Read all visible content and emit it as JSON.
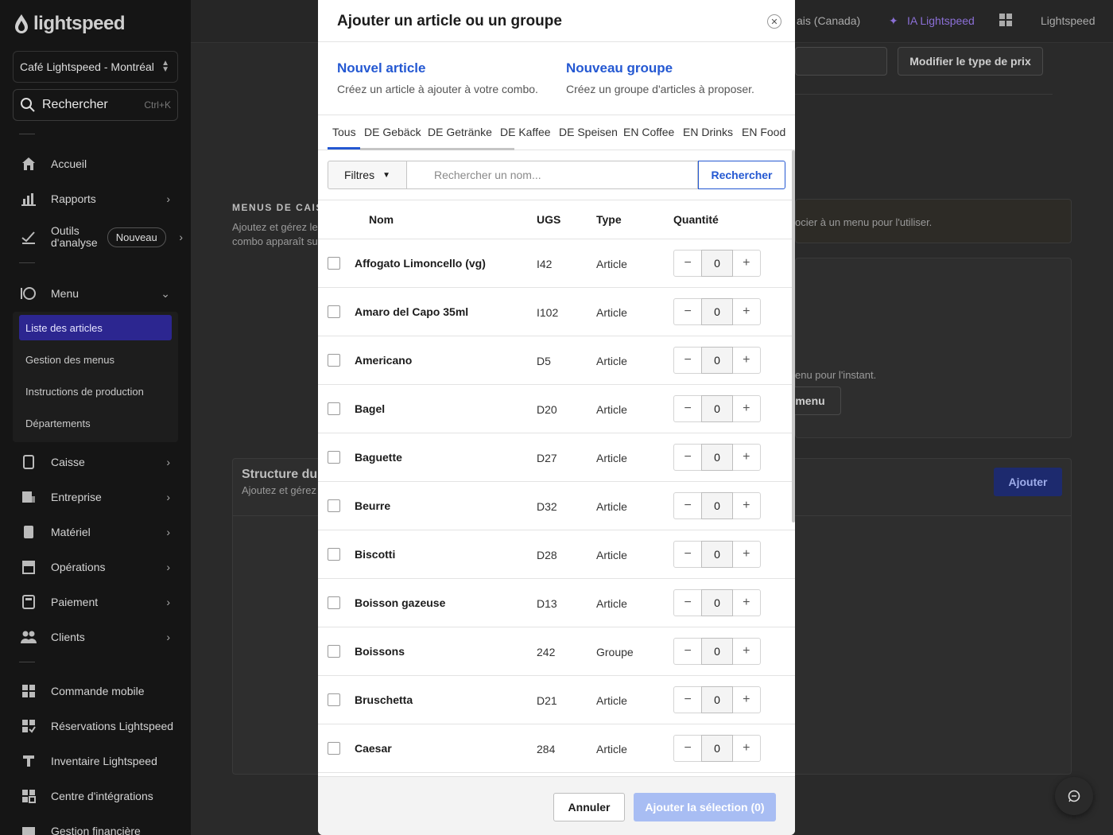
{
  "sidebar": {
    "brand": "lightspeed",
    "location": "Café Lightspeed - Montréal",
    "search_label": "Rechercher",
    "search_shortcut": "Ctrl+K",
    "items": [
      {
        "label": "Accueil"
      },
      {
        "label": "Rapports"
      },
      {
        "label": "Outils d'analyse",
        "line1": "Outils",
        "line2": "d'analyse",
        "badge": "Nouveau"
      },
      {
        "label": "Menu"
      },
      {
        "label": "Caisse"
      },
      {
        "label": "Entreprise"
      },
      {
        "label": "Matériel"
      },
      {
        "label": "Opérations"
      },
      {
        "label": "Paiement"
      },
      {
        "label": "Clients"
      },
      {
        "label": "Commande mobile"
      },
      {
        "label": "Réservations Lightspeed"
      },
      {
        "label": "Inventaire Lightspeed"
      },
      {
        "label": "Centre d'intégrations"
      },
      {
        "label": "Gestion financière"
      }
    ],
    "menu_sub": [
      "Liste des articles",
      "Gestion des menus",
      "Instructions de production",
      "Départements"
    ]
  },
  "background": {
    "topbar_language": "ais (Canada)",
    "topbar_ai": "IA Lightspeed",
    "topbar_account": "Lightspeed",
    "change_price_type": "Modifier le type de prix",
    "pos_menus_title": "MENUS DE CAIS",
    "pos_menus_desc1": "Ajoutez et gérez le",
    "pos_menus_desc2": "combo apparaît su",
    "associate_hint": "ocier à un menu pour l'utiliser.",
    "no_menu_text": "enu pour l'instant.",
    "menu_btn": "menu",
    "structure_title": "Structure du c",
    "structure_desc": "Ajoutez et gérez",
    "add_btn": "Ajouter"
  },
  "modal": {
    "title": "Ajouter un article ou un groupe",
    "new_item": {
      "title": "Nouvel article",
      "desc": "Créez un article à ajouter à votre combo."
    },
    "new_group": {
      "title": "Nouveau groupe",
      "desc": "Créez un groupe d'articles à proposer."
    },
    "tabs": [
      "Tous",
      "DE Gebäck",
      "DE Getränke",
      "DE Kaffee",
      "DE Speisen",
      "EN Coffee",
      "EN Drinks",
      "EN Food"
    ],
    "filters_label": "Filtres",
    "search_placeholder": "Rechercher un nom...",
    "search_button": "Rechercher",
    "columns": {
      "name": "Nom",
      "sku": "UGS",
      "type": "Type",
      "quantity": "Quantité"
    },
    "rows": [
      {
        "name": "Affogato Limoncello (vg)",
        "sku": "I42",
        "type": "Article",
        "qty": "0"
      },
      {
        "name": "Amaro del Capo 35ml",
        "sku": "I102",
        "type": "Article",
        "qty": "0"
      },
      {
        "name": "Americano",
        "sku": "D5",
        "type": "Article",
        "qty": "0"
      },
      {
        "name": "Bagel",
        "sku": "D20",
        "type": "Article",
        "qty": "0"
      },
      {
        "name": "Baguette",
        "sku": "D27",
        "type": "Article",
        "qty": "0"
      },
      {
        "name": "Beurre",
        "sku": "D32",
        "type": "Article",
        "qty": "0"
      },
      {
        "name": "Biscotti",
        "sku": "D28",
        "type": "Article",
        "qty": "0"
      },
      {
        "name": "Boisson gazeuse",
        "sku": "D13",
        "type": "Article",
        "qty": "0"
      },
      {
        "name": "Boissons",
        "sku": "242",
        "type": "Groupe",
        "qty": "0"
      },
      {
        "name": "Bruschetta",
        "sku": "D21",
        "type": "Article",
        "qty": "0"
      },
      {
        "name": "Caesar",
        "sku": "284",
        "type": "Article",
        "qty": "0"
      }
    ],
    "cancel_label": "Annuler",
    "confirm_label": "Ajouter la sélection (0)"
  },
  "colors": {
    "accent": "#2458d2",
    "active_nav": "#2c2690",
    "confirm_disabled": "#a8bdf3"
  }
}
